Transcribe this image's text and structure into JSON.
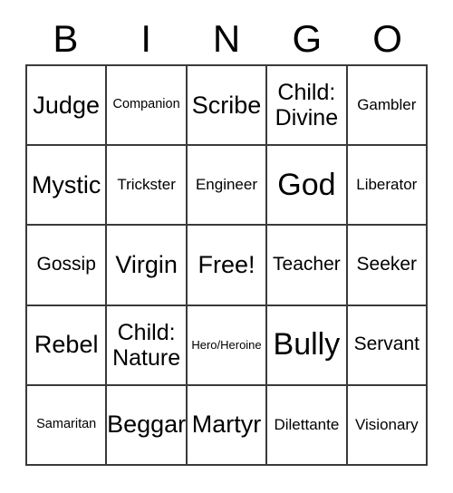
{
  "header": {
    "letters": [
      "B",
      "I",
      "N",
      "G",
      "O"
    ]
  },
  "grid": {
    "columns": 5,
    "rows": 5,
    "border_color": "#3a3a3a",
    "background_color": "#ffffff",
    "text_color": "#000000"
  },
  "cells": [
    {
      "label": "Judge",
      "size": "fs-xxl",
      "row": 1,
      "col": 1,
      "free": false
    },
    {
      "label": "Companion",
      "size": "fs-s",
      "row": 1,
      "col": 2,
      "free": false
    },
    {
      "label": "Scribe",
      "size": "fs-xxl",
      "row": 1,
      "col": 3,
      "free": false
    },
    {
      "label": "Child:\nDivine",
      "size": "fs-xl",
      "row": 1,
      "col": 4,
      "free": false
    },
    {
      "label": "Gambler",
      "size": "fs-m",
      "row": 1,
      "col": 5,
      "free": false
    },
    {
      "label": "Mystic",
      "size": "fs-xxl",
      "row": 2,
      "col": 1,
      "free": false
    },
    {
      "label": "Trickster",
      "size": "fs-m",
      "row": 2,
      "col": 2,
      "free": false
    },
    {
      "label": "Engineer",
      "size": "fs-m",
      "row": 2,
      "col": 3,
      "free": false
    },
    {
      "label": "God",
      "size": "fs-huge",
      "row": 2,
      "col": 4,
      "free": false
    },
    {
      "label": "Liberator",
      "size": "fs-m",
      "row": 2,
      "col": 5,
      "free": false
    },
    {
      "label": "Gossip",
      "size": "fs-l",
      "row": 3,
      "col": 1,
      "free": false
    },
    {
      "label": "Virgin",
      "size": "fs-xxl",
      "row": 3,
      "col": 2,
      "free": false
    },
    {
      "label": "Free!",
      "size": "fs-xxl",
      "row": 3,
      "col": 3,
      "free": true
    },
    {
      "label": "Teacher",
      "size": "fs-l",
      "row": 3,
      "col": 4,
      "free": false
    },
    {
      "label": "Seeker",
      "size": "fs-l",
      "row": 3,
      "col": 5,
      "free": false
    },
    {
      "label": "Rebel",
      "size": "fs-xxl",
      "row": 4,
      "col": 1,
      "free": false
    },
    {
      "label": "Child:\nNature",
      "size": "fs-xl",
      "row": 4,
      "col": 2,
      "free": false
    },
    {
      "label": "Hero/Heroine",
      "size": "fs-xs",
      "row": 4,
      "col": 3,
      "free": false
    },
    {
      "label": "Bully",
      "size": "fs-huge",
      "row": 4,
      "col": 4,
      "free": false
    },
    {
      "label": "Servant",
      "size": "fs-l",
      "row": 4,
      "col": 5,
      "free": false
    },
    {
      "label": "Samaritan",
      "size": "fs-s",
      "row": 5,
      "col": 1,
      "free": false
    },
    {
      "label": "Beggar",
      "size": "fs-xxl",
      "row": 5,
      "col": 2,
      "free": false
    },
    {
      "label": "Martyr",
      "size": "fs-xxl",
      "row": 5,
      "col": 3,
      "free": false
    },
    {
      "label": "Dilettante",
      "size": "fs-m",
      "row": 5,
      "col": 4,
      "free": false
    },
    {
      "label": "Visionary",
      "size": "fs-m",
      "row": 5,
      "col": 5,
      "free": false
    }
  ]
}
